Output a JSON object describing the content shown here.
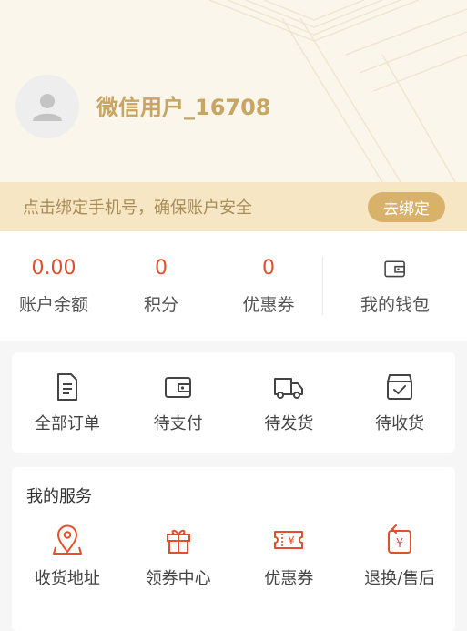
{
  "user": {
    "name": "微信用户_16708",
    "avatar_icon": "default-avatar-icon"
  },
  "bind_bar": {
    "text": "点击绑定手机号，确保账户安全",
    "button_label": "去绑定"
  },
  "stats": [
    {
      "value": "0.00",
      "label": "账户余额"
    },
    {
      "value": "0",
      "label": "积分"
    },
    {
      "value": "0",
      "label": "优惠券"
    }
  ],
  "wallet": {
    "label": "我的钱包",
    "icon": "wallet-icon"
  },
  "orders": [
    {
      "label": "全部订单",
      "icon": "document-icon"
    },
    {
      "label": "待支付",
      "icon": "wallet-icon"
    },
    {
      "label": "待发货",
      "icon": "truck-icon"
    },
    {
      "label": "待收货",
      "icon": "box-check-icon"
    }
  ],
  "services": {
    "title": "我的服务",
    "items": [
      {
        "label": "收货地址",
        "icon": "location-icon"
      },
      {
        "label": "领券中心",
        "icon": "gift-icon"
      },
      {
        "label": "优惠券",
        "icon": "coupon-icon"
      },
      {
        "label": "退换/售后",
        "icon": "refund-icon"
      }
    ]
  },
  "colors": {
    "accent": "#e0502e",
    "gold": "#c8a560",
    "bind_bg": "#f7e6c4",
    "button": "#d8b16a",
    "header_bg": "#fbf6ec"
  }
}
